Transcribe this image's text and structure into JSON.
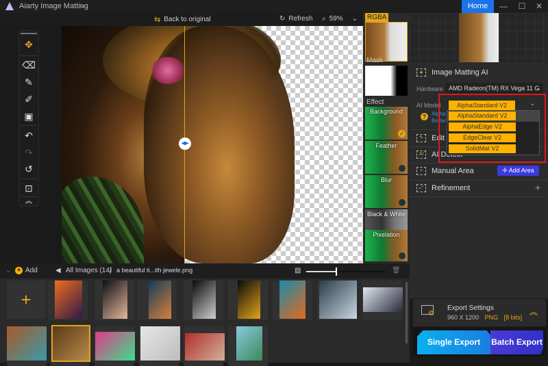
{
  "app": {
    "title": "Aiarty Image Matting",
    "home_label": "Home",
    "window_controls": [
      "minimize",
      "maximize",
      "close"
    ]
  },
  "toolbar": {
    "back_to_original": "Back to original",
    "refresh": "Refresh",
    "zoom_level": "59%"
  },
  "tools": [
    "move-tool",
    "eraser-tool",
    "brush-tool",
    "paint-tool",
    "roller-tool",
    "undo",
    "redo",
    "reset",
    "fit-view",
    "collapse"
  ],
  "layers": {
    "rgba_label": "RGBA",
    "mask_label": "Mask",
    "effect_label": "Effect",
    "effects": [
      {
        "label": "Background",
        "selected": true,
        "style": "green"
      },
      {
        "label": "Feather",
        "selected": false,
        "style": "green"
      },
      {
        "label": "Blur",
        "selected": false,
        "style": "green"
      },
      {
        "label": "Black & White",
        "selected": false,
        "style": "bw"
      },
      {
        "label": "Pixelation",
        "selected": false,
        "style": "green"
      }
    ]
  },
  "right_panel": {
    "section_title": "Image Matting AI",
    "hardware_label": "Hardware",
    "hardware_value": "AMD Radeon(TM) RX Vega 11 G",
    "ai_model_label": "AI Model",
    "ai_model_value": "AlphaStandard  V2",
    "help_text_1": "Alpha",
    "help_text_2": "Better",
    "model_options": [
      "AlphaStandard  V2",
      "AlphaEdge  V2",
      "EdgeClear  V2",
      "SolidMat  V2"
    ],
    "edit_label": "Edit",
    "ai_detect_label": "AI Detect",
    "manual_area_label": "Manual Area",
    "add_area_label": "Add Area",
    "refinement_label": "Refinement"
  },
  "export": {
    "title": "Export Settings",
    "resolution": "960 X 1200",
    "format": "PNG",
    "bits": "[8 bits]",
    "single_label": "Single Export",
    "batch_label": "Batch Export"
  },
  "gallery": {
    "add_label": "Add",
    "all_images": "All Images (14)",
    "separator": "/",
    "current_file": "a beautiful ti...ith jewele.png",
    "thumb_size_fraction": 0.37,
    "images": [
      {
        "name": "silhouette-woman",
        "colors": [
          "#f46b1c",
          "#2b1a4a"
        ]
      },
      {
        "name": "jellyfish",
        "colors": [
          "#0e0e14",
          "#e6b89a"
        ]
      },
      {
        "name": "woman-lights",
        "colors": [
          "#123a5a",
          "#d8823a"
        ]
      },
      {
        "name": "white-dancer",
        "colors": [
          "#0b0b0b",
          "#cfcfcf"
        ]
      },
      {
        "name": "daisy-dark",
        "colors": [
          "#0a0a0a",
          "#e3a51b"
        ]
      },
      {
        "name": "woman-orange-blue",
        "colors": [
          "#1a8ab0",
          "#e46a1a"
        ]
      },
      {
        "name": "girl-white-veil",
        "colors": [
          "#2a3d4a",
          "#c8d6e0"
        ]
      },
      {
        "name": "jumping-group",
        "colors": [
          "#dfe6ee",
          "#2a2a3a"
        ]
      },
      {
        "name": "blue-car",
        "colors": [
          "#a85a2a",
          "#3a9aa8"
        ]
      },
      {
        "name": "floral-woman",
        "colors": [
          "#5a3a1a",
          "#b88a4a"
        ]
      },
      {
        "name": "rainbow-dancer",
        "colors": [
          "#e03a8a",
          "#3ae08a"
        ]
      },
      {
        "name": "white-sofa",
        "colors": [
          "#e6e6e6",
          "#bdbdbd"
        ]
      },
      {
        "name": "red-hair",
        "colors": [
          "#b0302a",
          "#d0b09a"
        ]
      },
      {
        "name": "building-sky",
        "colors": [
          "#8ac8e0",
          "#3a8a5a"
        ]
      }
    ]
  }
}
